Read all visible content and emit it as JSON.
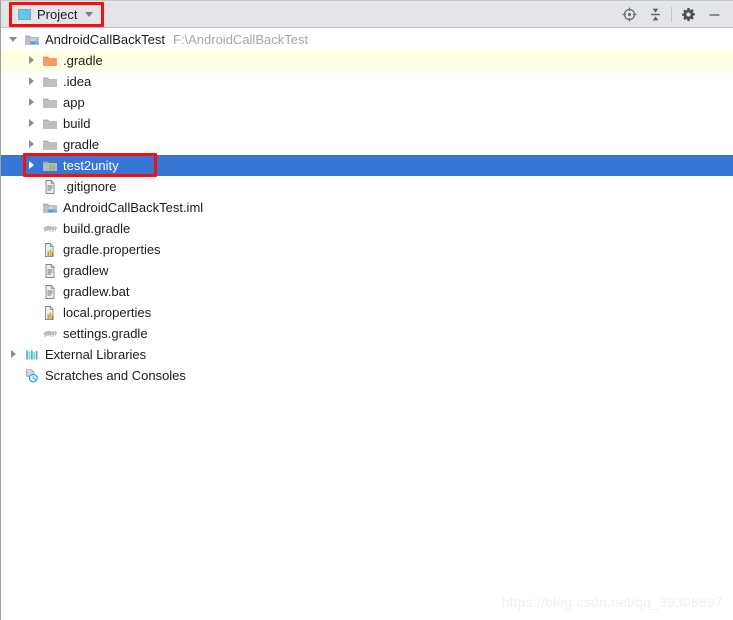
{
  "window": {
    "tab": {
      "label": "Project",
      "icon": "project-panel-icon",
      "dropdown_icon": "chevron-down-icon"
    },
    "toolbar": [
      {
        "name": "select-opened-file-icon",
        "tooltip": "Select Opened File"
      },
      {
        "name": "collapse-all-icon",
        "tooltip": "Collapse All"
      },
      {
        "name": "settings-gear-icon",
        "tooltip": "Settings"
      },
      {
        "name": "hide-icon",
        "tooltip": "Hide"
      }
    ]
  },
  "tree": {
    "items": [
      {
        "label": "AndroidCallBackTest",
        "path": "F:\\AndroidCallBackTest",
        "indent": 0,
        "arrow": "down",
        "icon": "module-java-icon",
        "state": "normal"
      },
      {
        "label": ".gradle",
        "path": "",
        "indent": 1,
        "arrow": "right",
        "icon": "folder-orange-icon",
        "state": "highlight"
      },
      {
        "label": ".idea",
        "path": "",
        "indent": 1,
        "arrow": "right",
        "icon": "folder-grey-icon",
        "state": "normal"
      },
      {
        "label": "app",
        "path": "",
        "indent": 1,
        "arrow": "right",
        "icon": "folder-grey-icon",
        "state": "normal"
      },
      {
        "label": "build",
        "path": "",
        "indent": 1,
        "arrow": "right",
        "icon": "folder-grey-icon",
        "state": "normal"
      },
      {
        "label": "gradle",
        "path": "",
        "indent": 1,
        "arrow": "right",
        "icon": "folder-grey-icon",
        "state": "normal"
      },
      {
        "label": "test2unity",
        "path": "",
        "indent": 1,
        "arrow": "right",
        "icon": "module-library-icon",
        "state": "selected"
      },
      {
        "label": ".gitignore",
        "path": "",
        "indent": 1,
        "arrow": "none",
        "icon": "text-file-icon",
        "state": "normal"
      },
      {
        "label": "AndroidCallBackTest.iml",
        "path": "",
        "indent": 1,
        "arrow": "none",
        "icon": "module-java-icon",
        "state": "normal"
      },
      {
        "label": "build.gradle",
        "path": "",
        "indent": 1,
        "arrow": "none",
        "icon": "gradle-elephant-icon",
        "state": "normal"
      },
      {
        "label": "gradle.properties",
        "path": "",
        "indent": 1,
        "arrow": "none",
        "icon": "properties-file-icon",
        "state": "normal"
      },
      {
        "label": "gradlew",
        "path": "",
        "indent": 1,
        "arrow": "none",
        "icon": "text-file-icon",
        "state": "normal"
      },
      {
        "label": "gradlew.bat",
        "path": "",
        "indent": 1,
        "arrow": "none",
        "icon": "text-file-icon",
        "state": "normal"
      },
      {
        "label": "local.properties",
        "path": "",
        "indent": 1,
        "arrow": "none",
        "icon": "properties-file-icon",
        "state": "normal"
      },
      {
        "label": "settings.gradle",
        "path": "",
        "indent": 1,
        "arrow": "none",
        "icon": "gradle-elephant-icon",
        "state": "normal"
      },
      {
        "label": "External Libraries",
        "path": "",
        "indent": 0,
        "arrow": "right",
        "icon": "external-libraries-icon",
        "state": "normal"
      },
      {
        "label": "Scratches and Consoles",
        "path": "",
        "indent": 0,
        "arrow": "none",
        "icon": "scratches-clock-icon",
        "state": "normal"
      }
    ]
  },
  "annotations": [
    {
      "name": "annotation-box-project-tab",
      "color": "#fc0d0d"
    },
    {
      "name": "annotation-box-test2unity-row",
      "color": "#fc0d0d"
    }
  ],
  "watermark": {
    "text": "https://blog.csdn.net/qq_39308897"
  },
  "colors": {
    "header_bg": "#e3e5e9",
    "selection_blue": "#3776d4",
    "highlight_yellow": "#ffffe4",
    "annotation_red": "#fc0d0d"
  }
}
